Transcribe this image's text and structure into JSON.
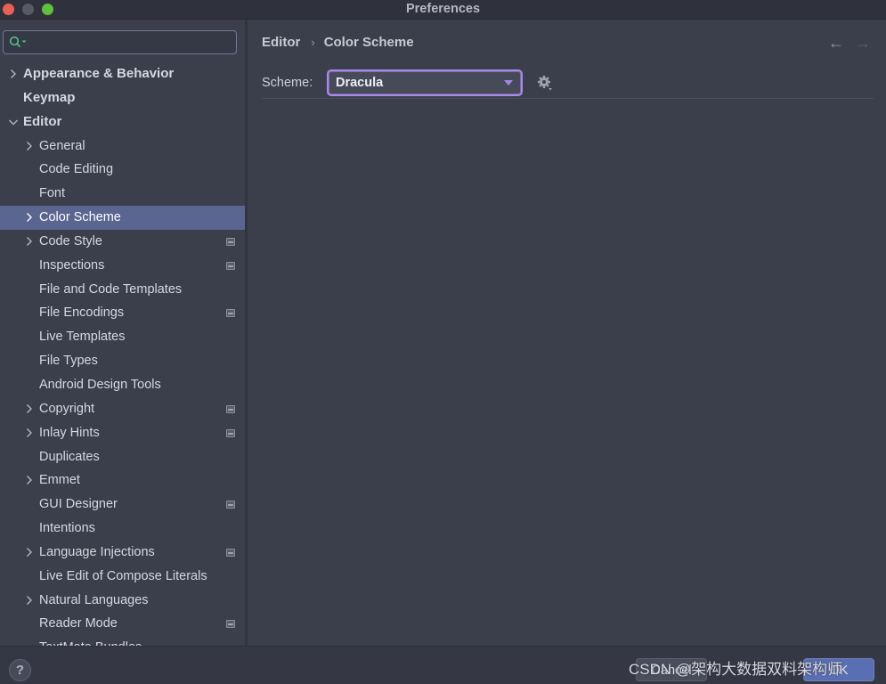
{
  "window": {
    "title": "Preferences"
  },
  "search": {
    "value": "",
    "placeholder": ""
  },
  "sidebar": {
    "items": [
      {
        "label": "Appearance & Behavior",
        "bold": true,
        "level": 0,
        "chevron": "right",
        "project": false
      },
      {
        "label": "Keymap",
        "bold": true,
        "level": 0,
        "chevron": "none",
        "project": false
      },
      {
        "label": "Editor",
        "bold": true,
        "level": 0,
        "chevron": "down",
        "project": false
      },
      {
        "label": "General",
        "bold": false,
        "level": 1,
        "chevron": "right",
        "project": false
      },
      {
        "label": "Code Editing",
        "bold": false,
        "level": 1,
        "chevron": "none",
        "project": false
      },
      {
        "label": "Font",
        "bold": false,
        "level": 1,
        "chevron": "none",
        "project": false
      },
      {
        "label": "Color Scheme",
        "bold": false,
        "level": 1,
        "chevron": "right",
        "project": false,
        "selected": true
      },
      {
        "label": "Code Style",
        "bold": false,
        "level": 1,
        "chevron": "right",
        "project": true
      },
      {
        "label": "Inspections",
        "bold": false,
        "level": 1,
        "chevron": "none",
        "project": true
      },
      {
        "label": "File and Code Templates",
        "bold": false,
        "level": 1,
        "chevron": "none",
        "project": false
      },
      {
        "label": "File Encodings",
        "bold": false,
        "level": 1,
        "chevron": "none",
        "project": true
      },
      {
        "label": "Live Templates",
        "bold": false,
        "level": 1,
        "chevron": "none",
        "project": false
      },
      {
        "label": "File Types",
        "bold": false,
        "level": 1,
        "chevron": "none",
        "project": false
      },
      {
        "label": "Android Design Tools",
        "bold": false,
        "level": 1,
        "chevron": "none",
        "project": false
      },
      {
        "label": "Copyright",
        "bold": false,
        "level": 1,
        "chevron": "right",
        "project": true
      },
      {
        "label": "Inlay Hints",
        "bold": false,
        "level": 1,
        "chevron": "right",
        "project": true
      },
      {
        "label": "Duplicates",
        "bold": false,
        "level": 1,
        "chevron": "none",
        "project": false
      },
      {
        "label": "Emmet",
        "bold": false,
        "level": 1,
        "chevron": "right",
        "project": false
      },
      {
        "label": "GUI Designer",
        "bold": false,
        "level": 1,
        "chevron": "none",
        "project": true
      },
      {
        "label": "Intentions",
        "bold": false,
        "level": 1,
        "chevron": "none",
        "project": false
      },
      {
        "label": "Language Injections",
        "bold": false,
        "level": 1,
        "chevron": "right",
        "project": true
      },
      {
        "label": "Live Edit of Compose Literals",
        "bold": false,
        "level": 1,
        "chevron": "none",
        "project": false
      },
      {
        "label": "Natural Languages",
        "bold": false,
        "level": 1,
        "chevron": "right",
        "project": false
      },
      {
        "label": "Reader Mode",
        "bold": false,
        "level": 1,
        "chevron": "none",
        "project": true
      },
      {
        "label": "TextMate Bundles",
        "bold": false,
        "level": 1,
        "chevron": "none",
        "project": false
      }
    ]
  },
  "main": {
    "breadcrumb": [
      "Editor",
      "Color Scheme"
    ],
    "scheme_label": "Scheme:",
    "scheme_value": "Dracula"
  },
  "footer": {
    "help": "?",
    "cancel_label": "Cancel",
    "ok_label": "OK",
    "watermark": "CSDN @架构大数据双料架构师"
  },
  "colors": {
    "background": "#3b3e4b",
    "selection": "#5a6590",
    "accent": "#a88be8",
    "ok_button": "#5a6fb2"
  }
}
